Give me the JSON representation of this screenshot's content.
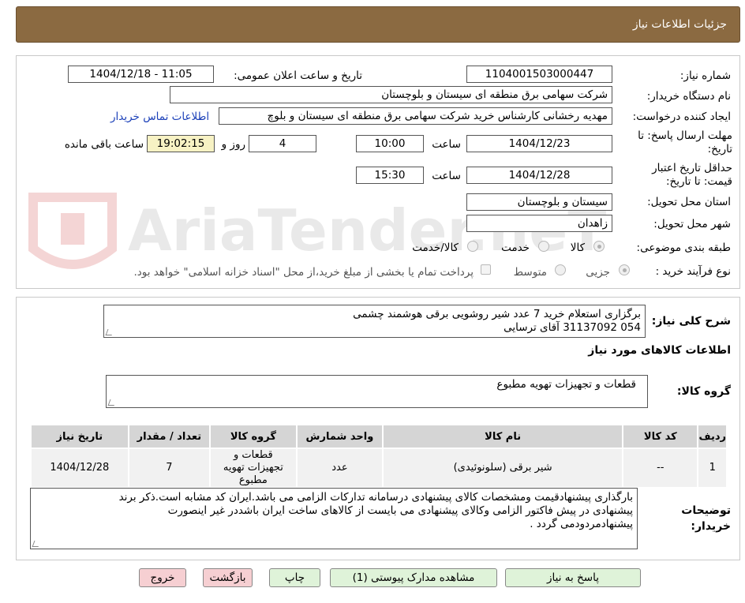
{
  "header": {
    "title": "جزئیات اطلاعات نیاز"
  },
  "labels": {
    "need_number": "شماره نیاز:",
    "announce_datetime": "تاریخ و ساعت اعلان عمومی:",
    "buyer_org": "نام دستگاه خریدار:",
    "requester": "ایجاد کننده درخواست:",
    "reply_deadline": "مهلت ارسال پاسخ: تا تاریخ:",
    "hour": "ساعت",
    "day_and": "روز و",
    "remaining": "ساعت باقی مانده",
    "price_validity": "حداقل تاریخ اعتبار قیمت: تا تاریخ:",
    "province": "استان محل تحویل:",
    "city": "شهر محل تحویل:",
    "category": "طبقه بندی موضوعی:",
    "purchase_type": "نوع فرآیند خرید :",
    "summary": "شرح کلی نیاز:",
    "goods_info": "اطلاعات کالاهای مورد نیاز",
    "goods_group": "گروه کالا:",
    "buyer_notes": "توضیحات خریدار:"
  },
  "values": {
    "need_number": "1104001503000447",
    "announce_datetime": "1404/12/18 - 11:05",
    "buyer_org": "شرکت سهامی برق منطقه ای سیستان و بلوچستان",
    "requester": "مهدیه رخشانی کارشناس خرید شرکت سهامی برق منطقه ای سیستان و بلوچ",
    "contact_link": "اطلاعات تماس خریدار",
    "reply_date": "1404/12/23",
    "reply_time": "10:00",
    "days_left": "4",
    "time_left": "19:02:15",
    "validity_date": "1404/12/28",
    "validity_time": "15:30",
    "province": "سیستان و بلوچستان",
    "city": "زاهدان"
  },
  "category_options": [
    "کالا",
    "خدمت",
    "کالا/خدمت"
  ],
  "purchase_options": [
    "جزیی",
    "متوسط"
  ],
  "payment_note": "پرداخت تمام یا بخشی از مبلغ خرید،از محل \"اسناد خزانه اسلامی\" خواهد بود.",
  "summary_lines": [
    "برگزاری استعلام خرید 7 عدد شیر روشویی برقی هوشمند چشمی",
    "054 31137092 آقای ترسایی"
  ],
  "goods_group_value": "قطعات و تجهیزات تهویه مطبوع",
  "table": {
    "headers": [
      "ردیف",
      "کد کالا",
      "نام کالا",
      "واحد شمارش",
      "گروه کالا",
      "تعداد / مقدار",
      "تاریخ نیاز"
    ],
    "rows": [
      [
        "1",
        "--",
        "شیر برقی (سلونوئیدی)",
        "عدد",
        "قطعات و تجهیزات تهویه مطبوع",
        "7",
        "1404/12/28"
      ]
    ]
  },
  "notes_lines": [
    "بارگذاری پیشنهادقیمت ومشخصات کالای پیشنهادی درسامانه تدارکات الزامی می باشد.ایران کد مشابه است.ذکر برند",
    "پیشنهادی در پیش فاکتور الزامی وکالای پیشنهادی می بایست از کالاهای ساخت ایران باشددر غیر اینصورت",
    "پیشنهادمردودمی گردد ."
  ],
  "buttons": {
    "reply": "پاسخ به نیاز",
    "attachments": "مشاهده مدارک پیوستی (1)",
    "print": "چاپ",
    "back": "بازگشت",
    "exit": "خروج"
  },
  "watermark": "AriaTender.neT",
  "colors": {
    "header_bg": "#8b6a41",
    "link": "#1a3fb8",
    "green_btn": "#dff3d9",
    "red_btn": "#f6cfd2",
    "highlight": "#f7f2c4"
  }
}
